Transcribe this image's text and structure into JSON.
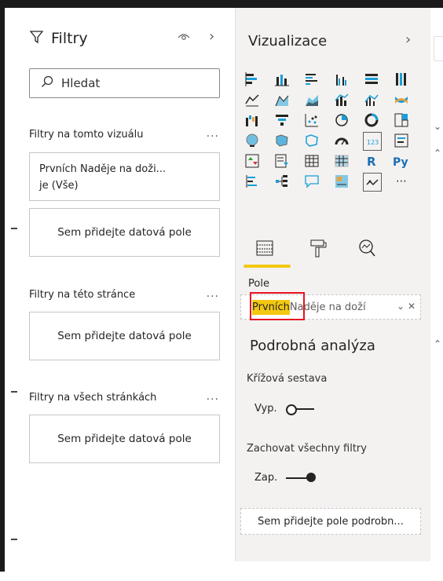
{
  "filters": {
    "title": "Filtry",
    "search_label": "Hledat",
    "visual_section": {
      "title": "Filtry na tomto vizuálu",
      "card_line1": "Prvních Naděje na doži...",
      "card_line2": "je (Vše)",
      "drop_label": "Sem přidejte datová pole"
    },
    "page_section": {
      "title": "Filtry na této stránce",
      "drop_label": "Sem přidejte datová pole"
    },
    "all_pages_section": {
      "title": "Filtry na všech stránkách",
      "drop_label": "Sem přidejte datová pole"
    },
    "more_label": "..."
  },
  "viz": {
    "title": "Vizualizace",
    "field_section_label": "Pole",
    "field_highlight": "Prvních",
    "field_rest": " Naděje na doží",
    "drill": {
      "title": "Podrobná analýza",
      "cross_report_label": "Křížová sestava",
      "cross_report_state": "Vyp.",
      "keep_filters_label": "Zachovat všechny filtry",
      "keep_filters_state": "Zap.",
      "add_field_label": "Sem přidejte pole podrobn..."
    }
  },
  "colors": {
    "accent_yellow": "#f2c811",
    "highlight_box": "#e81123",
    "pane_bg": "#f3f2f1"
  }
}
